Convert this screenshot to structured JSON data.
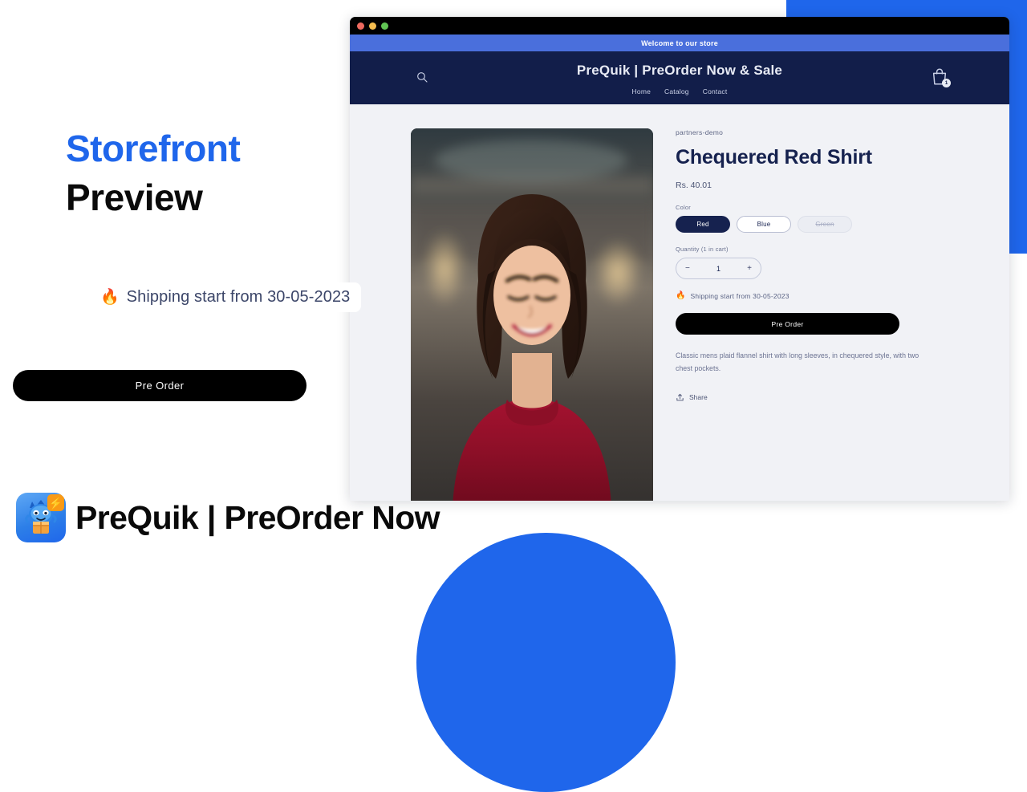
{
  "promo": {
    "headline_accent": "Storefront",
    "headline_rest": "Preview",
    "shipping_callout": {
      "icon": "fire-icon",
      "glyph": "🔥",
      "text": "Shipping start from 30-05-2023"
    },
    "preorder_button_label": "Pre Order",
    "accent_color": "#1f66eb",
    "text_color": "#0a0a0a"
  },
  "brand": {
    "name": "PreQuik | PreOrder Now",
    "icon": "prequik-app-icon",
    "badge_glyph": "⚡",
    "icon_bg": "#2d7fe8",
    "badge_bg": "#f99a16"
  },
  "browser": {
    "traffic_lights": [
      "close-red",
      "minimize-yellow",
      "maximize-green"
    ],
    "colors": {
      "titlebar": "#000000",
      "announcement": "#4a6fdc",
      "header": "#121e4a",
      "page_bg": "#f1f2f6"
    }
  },
  "storefront": {
    "announcement": "Welcome to our store",
    "title": "PreQuik | PreOrder Now & Sale",
    "nav": [
      {
        "label": "Home"
      },
      {
        "label": "Catalog"
      },
      {
        "label": "Contact"
      }
    ],
    "search_icon": "search-icon",
    "cart_icon": "shopping-bag-icon",
    "cart_count": "1"
  },
  "product": {
    "vendor": "partners-demo",
    "title": "Chequered Red Shirt",
    "price": "Rs. 40.01",
    "image_alt": "smiling-woman-in-red-top",
    "color_option": {
      "label": "Color",
      "values": [
        {
          "label": "Red",
          "state": "selected"
        },
        {
          "label": "Blue",
          "state": "available"
        },
        {
          "label": "Green",
          "state": "unavailable"
        }
      ]
    },
    "quantity": {
      "label": "Quantity (1 in cart)",
      "decrement": "−",
      "value": "1",
      "increment": "+"
    },
    "shipping_note": {
      "glyph": "🔥",
      "text": "Shipping start from 30-05-2023"
    },
    "cta_label": "Pre Order",
    "description": "Classic mens plaid flannel shirt with long sleeves, in chequered style, with two chest pockets.",
    "share_label": "Share"
  }
}
